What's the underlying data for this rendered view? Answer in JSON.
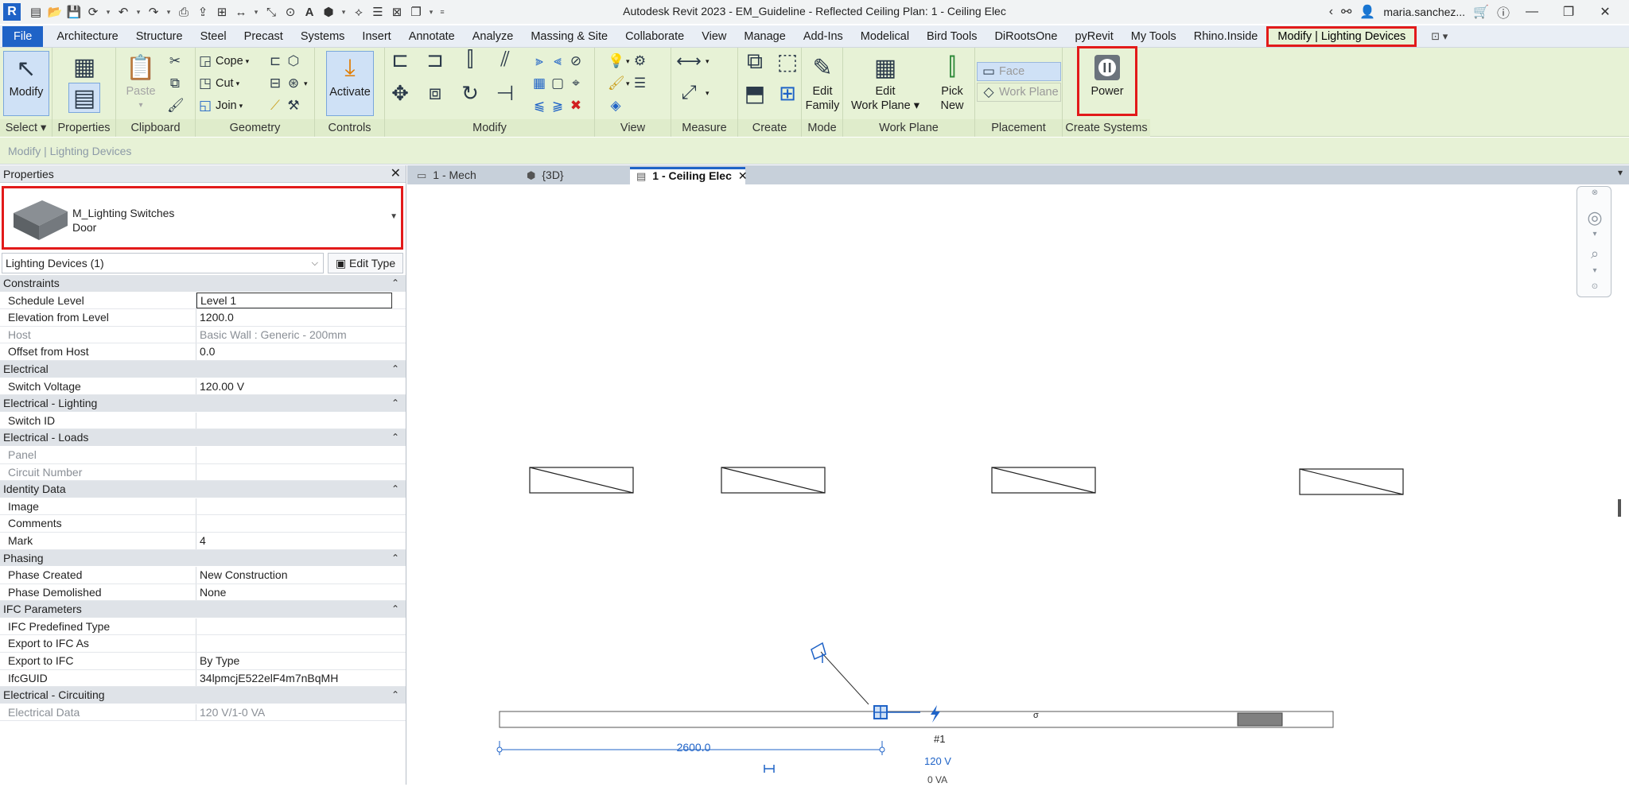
{
  "app": {
    "title": "Autodesk Revit 2023 - EM_Guideline - Reflected Ceiling Plan: 1 - Ceiling Elec",
    "logo_letter": "R",
    "user": "maria.sanchez..."
  },
  "ribbon_tabs": [
    "File",
    "Architecture",
    "Structure",
    "Steel",
    "Precast",
    "Systems",
    "Insert",
    "Annotate",
    "Analyze",
    "Massing & Site",
    "Collaborate",
    "View",
    "Manage",
    "Add-Ins",
    "Modelical",
    "Bird Tools",
    "DiRootsOne",
    "pyRevit",
    "My Tools",
    "Rhino.Inside",
    "Modify | Lighting Devices"
  ],
  "ribbon": {
    "select": {
      "modify_label": "Modify",
      "panel": "Select"
    },
    "properties": {
      "panel": "Properties"
    },
    "clipboard": {
      "paste_label": "Paste",
      "panel": "Clipboard"
    },
    "geometry": {
      "cope_label": "Cope",
      "cut_label": "Cut",
      "join_label": "Join",
      "panel": "Geometry"
    },
    "controls": {
      "activate_label": "Activate",
      "panel": "Controls"
    },
    "modify": {
      "panel": "Modify"
    },
    "view": {
      "panel": "View"
    },
    "measure": {
      "panel": "Measure"
    },
    "create": {
      "panel": "Create"
    },
    "mode": {
      "edit_family_l1": "Edit",
      "edit_family_l2": "Family",
      "panel": "Mode"
    },
    "work_plane": {
      "edit_wp_l1": "Edit",
      "edit_wp_l2": "Work Plane",
      "pick_new_l1": "Pick",
      "pick_new_l2": "New",
      "panel": "Work Plane"
    },
    "placement": {
      "face_label": "Face",
      "work_plane_label": "Work Plane",
      "panel": "Placement"
    },
    "create_systems": {
      "power_label": "Power",
      "panel": "Create Systems"
    }
  },
  "options_bar": {
    "context_label": "Modify | Lighting Devices"
  },
  "properties": {
    "title": "Properties",
    "type_family": "M_Lighting Switches",
    "type_name": "Door",
    "instance_selector": "Lighting Devices (1)",
    "edit_type_label": "Edit Type",
    "groups": [
      {
        "name": "Constraints",
        "rows": [
          {
            "key": "Schedule Level",
            "value": "Level 1",
            "readonly": false
          },
          {
            "key": "Elevation from Level",
            "value": "1200.0",
            "readonly": false
          },
          {
            "key": "Host",
            "value": "Basic Wall : Generic - 200mm",
            "readonly": true
          },
          {
            "key": "Offset from Host",
            "value": "0.0",
            "readonly": false
          }
        ]
      },
      {
        "name": "Electrical",
        "rows": [
          {
            "key": "Switch Voltage",
            "value": "120.00 V",
            "readonly": false
          }
        ]
      },
      {
        "name": "Electrical - Lighting",
        "rows": [
          {
            "key": "Switch ID",
            "value": "",
            "readonly": false
          }
        ]
      },
      {
        "name": "Electrical - Loads",
        "rows": [
          {
            "key": "Panel",
            "value": "",
            "readonly": true
          },
          {
            "key": "Circuit Number",
            "value": "",
            "readonly": true
          }
        ]
      },
      {
        "name": "Identity Data",
        "rows": [
          {
            "key": "Image",
            "value": "",
            "readonly": false
          },
          {
            "key": "Comments",
            "value": "",
            "readonly": false
          },
          {
            "key": "Mark",
            "value": "4",
            "readonly": false
          }
        ]
      },
      {
        "name": "Phasing",
        "rows": [
          {
            "key": "Phase Created",
            "value": "New Construction",
            "readonly": false
          },
          {
            "key": "Phase Demolished",
            "value": "None",
            "readonly": false
          }
        ]
      },
      {
        "name": "IFC Parameters",
        "rows": [
          {
            "key": "IFC Predefined Type",
            "value": "",
            "readonly": false
          },
          {
            "key": "Export to IFC As",
            "value": "",
            "readonly": false
          },
          {
            "key": "Export to IFC",
            "value": "By Type",
            "readonly": false
          },
          {
            "key": "IfcGUID",
            "value": "34lpmcjE522elF4m7nBqMH",
            "readonly": false
          }
        ]
      },
      {
        "name": "Electrical - Circuiting",
        "rows": [
          {
            "key": "Electrical Data",
            "value": "120 V/1-0 VA",
            "readonly": true
          }
        ]
      }
    ]
  },
  "view_tabs": [
    {
      "label": "1 - Mech",
      "active": false
    },
    {
      "label": "{3D}",
      "active": false
    },
    {
      "label": "1 - Ceiling Elec",
      "active": true
    }
  ],
  "canvas": {
    "dimension_value": "2600.0",
    "tag_number": "#1",
    "tag_voltage": "120 V",
    "tag_load": "0 VA"
  },
  "colors": {
    "accent": "#1f63c7",
    "highlight": "#e21a1a",
    "ribbon_bg": "#e7f2d6"
  }
}
